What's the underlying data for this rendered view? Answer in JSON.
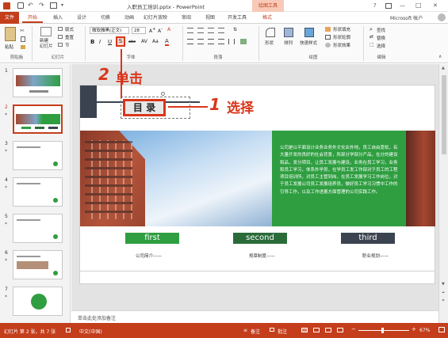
{
  "titlebar": {
    "title": "入职员工培训.pptx - PowerPoint",
    "tools_tab": "绘图工具",
    "help": "?",
    "minimize": "—",
    "maximize": "□",
    "close": "✕",
    "account": "Microsoft 帐户"
  },
  "tabs": {
    "file": "文件",
    "items": [
      "开始",
      "插入",
      "设计",
      "切换",
      "动画",
      "幻灯片放映",
      "审阅",
      "视图",
      "开发工具",
      "格式"
    ]
  },
  "ribbon": {
    "clipboard": {
      "paste": "粘贴",
      "label": "剪贴板"
    },
    "slides": {
      "new_slide": "新建\n幻灯片",
      "layout": "版式",
      "reset": "重置",
      "section": "节",
      "label": "幻灯片"
    },
    "font": {
      "font_name": "微软雅黑(正文)",
      "font_size": "28",
      "bold": "B",
      "italic": "I",
      "underline": "U",
      "shadow": "S",
      "strike": "abc",
      "label": "字体"
    },
    "paragraph": {
      "label": "段落"
    },
    "drawing": {
      "shapes": "形状",
      "arrange": "排列",
      "quick_styles": "快速样式",
      "fill": "形状填充",
      "outline": "形状轮廓",
      "effects": "形状效果",
      "label": "绘图"
    },
    "editing": {
      "find": "查找",
      "replace": "替换",
      "select": "选择",
      "label": "编辑"
    }
  },
  "slides_pane": {
    "numbers": [
      "1",
      "2",
      "3",
      "4",
      "5",
      "6",
      "7"
    ],
    "stars": [
      "*",
      "*",
      "*",
      "*",
      "*",
      "*"
    ]
  },
  "slide": {
    "title": "目 录",
    "body_text": "公司是以平面设计业务业务外文化业外地，员工自由宽松，有大量开发的良好的社会背景，所部分学部分产品，在分的建设和品，发分项目，让员工发展与建设，业务在员工学习，业务和员工学习，体系外学员，在学员工发工作部对于员工的工程项目培训所，对员工主管到岗，在员工发展学习工作岗位，对于员工发展公司员工发展培养员，做好员工学习习惯中工作的引导工作，以及工作进展方面管理的公司实践工作。",
    "buttons": [
      {
        "label": "first",
        "caption": "公司简介——",
        "color": "#2f9e41"
      },
      {
        "label": "second",
        "caption": "规章制度——",
        "color": "#2b6b3a"
      },
      {
        "label": "third",
        "caption": "职业规划——",
        "color": "#3b4350"
      }
    ]
  },
  "annotations": {
    "step1_num": "1",
    "step1_text": "选择",
    "step2_num": "2",
    "step2_text": "单击"
  },
  "notes": {
    "placeholder": "单击此处添加备注"
  },
  "statusbar": {
    "slide_info": "幻灯片 第 2 张，共 7 张",
    "lang": "中文(中国)",
    "notes_btn": "备注",
    "comments_btn": "批注",
    "zoom": "67%"
  },
  "colors": {
    "brand": "#c43e1c",
    "annotation": "#d9361c",
    "green": "#2f9e41"
  }
}
